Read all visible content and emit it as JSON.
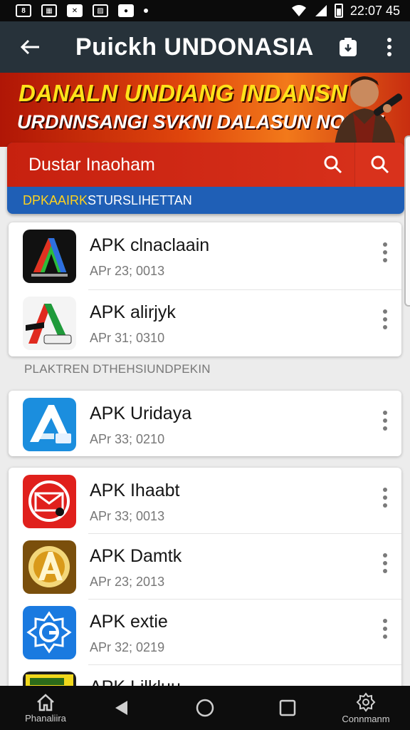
{
  "status_bar": {
    "time": "22:07 45"
  },
  "app_bar": {
    "title": "Puickh UNDONASIA"
  },
  "banner": {
    "headline": "DANALN UNDIANG INDANSN",
    "subline": "URDNNSANGI SVKNI DALASUN NORAI!"
  },
  "search": {
    "query": "Dustar Inaoham",
    "subbar_highlight": "DPKAAIRK",
    "subbar_text": " STURSLIHETTAN"
  },
  "section_label": "PLAKTREN DTHEHSIUNDPEKIN",
  "apps_group1": [
    {
      "name": "APK clnaclaain",
      "date": "APr 23; 0013",
      "icon": "apk-a-dark-icon"
    },
    {
      "name": "APK alirjyk",
      "date": "APr 31; 0310",
      "icon": "apk-a-red-green-icon"
    }
  ],
  "apps_group2": [
    {
      "name": "APK Uridaya",
      "date": "APr 33; 0210",
      "icon": "apk-a-blue-icon"
    }
  ],
  "apps_group3": [
    {
      "name": "APK Ihaabt",
      "date": "APr 33; 0013",
      "icon": "apk-mail-red-icon"
    },
    {
      "name": "APK Damtk",
      "date": "APr 23; 2013",
      "icon": "apk-a-gold-icon"
    },
    {
      "name": "APK extie",
      "date": "APr 32; 0219",
      "icon": "apk-gear-blue-icon"
    },
    {
      "name": "APK Lilkluu",
      "date": "",
      "icon": "apk-yellow-icon"
    }
  ],
  "nav": {
    "home_label": "Phanaliira",
    "settings_label": "Connmanm"
  },
  "colors": {
    "appbar": "#27323a",
    "search_red": "#c7210f",
    "sub_blue": "#1f5fb6",
    "banner_yellow": "#ffe21a"
  }
}
